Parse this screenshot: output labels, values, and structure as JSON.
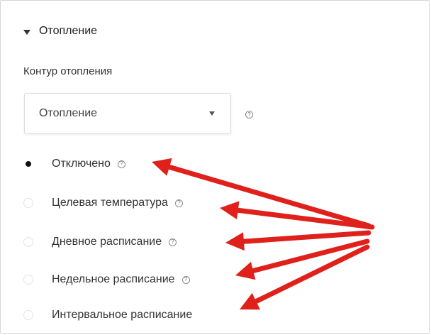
{
  "section": {
    "title": "Отопление",
    "expanded": true
  },
  "field": {
    "label": "Контур отопления",
    "select_value": "Отопление",
    "help_glyph": "?"
  },
  "options": [
    {
      "label": "Отключено",
      "selected": true,
      "help_glyph": "?"
    },
    {
      "label": "Целевая температура",
      "selected": false,
      "help_glyph": "?"
    },
    {
      "label": "Дневное расписание",
      "selected": false,
      "help_glyph": "?"
    },
    {
      "label": "Недельное расписание",
      "selected": false,
      "help_glyph": "?"
    },
    {
      "label": "Интервальное расписание",
      "selected": false,
      "help_glyph": ""
    }
  ],
  "annotation": {
    "arrow_color": "#e0201b"
  }
}
